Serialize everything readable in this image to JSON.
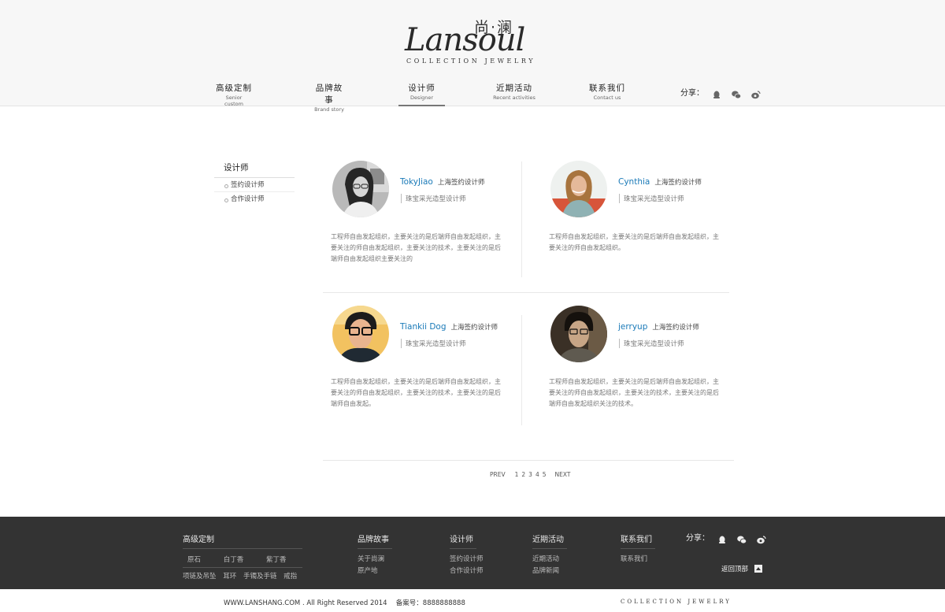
{
  "brand": {
    "script": "Lansoul",
    "cn": "尚·澜",
    "tagline": "COLLECTION JEWELRY"
  },
  "nav": [
    {
      "cn": "高级定制",
      "en": "Senior custom"
    },
    {
      "cn": "品牌故事",
      "en": "Brand story"
    },
    {
      "cn": "设计师",
      "en": "Designer",
      "active": true
    },
    {
      "cn": "近期活动",
      "en": "Recent activities"
    },
    {
      "cn": "联系我们",
      "en": "Contact us"
    }
  ],
  "share": {
    "label": "分享：",
    "icons": [
      "qq-icon",
      "wechat-icon",
      "weibo-icon"
    ]
  },
  "sidebar": {
    "title": "设计师",
    "items": [
      {
        "label": "签约设计师"
      },
      {
        "label": "合作设计师"
      }
    ]
  },
  "designers": [
    {
      "name": "TokyJiao",
      "role": "上海签约设计师",
      "spec": "珠宝采光造型设计师",
      "desc": "工程师自由发起组织，主要关注的是后端师自由发起组织，主要关注的师自由发起组织，主要关注的技术，主要关注的是后端师自由发起组织主要关注的"
    },
    {
      "name": "Cynthia",
      "role": "上海签约设计师",
      "spec": "珠宝采光造型设计师",
      "desc": "工程师自由发起组织，主要关注的是后端师自由发起组织，主要关注的师自由发起组织。"
    },
    {
      "name": "Tiankii Dog",
      "role": "上海签约设计师",
      "spec": "珠宝采光造型设计师",
      "desc": "工程师自由发起组织，主要关注的是后端师自由发起组织，主要关注的师自由发起组织，主要关注的技术，主要关注的是后端师自由发起。"
    },
    {
      "name": "jerryup",
      "role": "上海签约设计师",
      "spec": "珠宝采光造型设计师",
      "desc": "工程师自由发起组织，主要关注的是后端师自由发起组织，主要关注的师自由发起组织，主要关注的技术，主要关注的是后端师自由发起组织关注的技术。"
    }
  ],
  "pager": {
    "prev": "PREV",
    "pages": [
      "1",
      "2",
      "3",
      "4",
      "5"
    ],
    "next": "NEXT"
  },
  "footer": {
    "cols": [
      {
        "title": "高级定制",
        "links": [
          "原石",
          "白丁香",
          "紫丁香",
          "项链及吊坠",
          "耳环",
          "手镯及手链",
          "戒指"
        ]
      },
      {
        "title": "品牌故事",
        "links": [
          "关于尚澜",
          "原产地"
        ]
      },
      {
        "title": "设计师",
        "links": [
          "签约设计师",
          "合作设计师"
        ]
      },
      {
        "title": "近期活动",
        "links": [
          "近期活动",
          "品牌新闻"
        ]
      },
      {
        "title": "联系我们",
        "links": [
          "联系我们"
        ]
      }
    ],
    "share_label": "分享：",
    "back_top": "返回顶部",
    "copyright": "WWW.LANSHANG.COM . All Right Reserved 2014 　备案号：8888888888",
    "tagline": "COLLECTION JEWELRY"
  },
  "colors": {
    "accent": "#1a7ab8",
    "footer_bg": "#333333",
    "header_bg": "#f7f7f7"
  }
}
